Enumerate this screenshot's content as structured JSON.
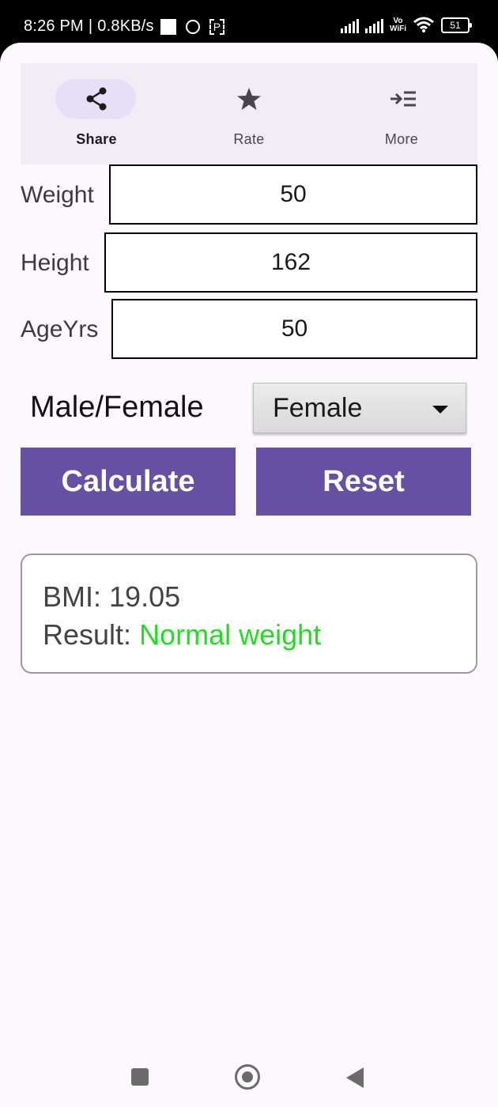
{
  "status_bar": {
    "time": "8:26 PM",
    "network_speed": "0.8KB/s",
    "vowifi_top": "Vo",
    "vowifi_bottom": "WiFi",
    "battery": "51",
    "icons": [
      "notification-square-icon",
      "app-badge-icon",
      "p-icon",
      "signal-icon",
      "wifi-icon",
      "battery-icon"
    ]
  },
  "top_nav": {
    "items": [
      {
        "label": "Share",
        "icon": "share-icon",
        "active": true
      },
      {
        "label": "Rate",
        "icon": "star-icon",
        "active": false
      },
      {
        "label": "More",
        "icon": "more-list-icon",
        "active": false
      }
    ]
  },
  "form": {
    "weight": {
      "label": "Weight",
      "value": "50"
    },
    "height": {
      "label": "Height",
      "value": "162"
    },
    "age": {
      "label": "AgeYrs",
      "value": "50"
    },
    "gender": {
      "label": "Male/Female",
      "selected": "Female"
    }
  },
  "actions": {
    "calculate_label": "Calculate",
    "reset_label": "Reset"
  },
  "result": {
    "bmi_label": "BMI:",
    "bmi_value": "19.05",
    "result_label": "Result:",
    "result_value": "Normal weight"
  },
  "colors": {
    "accent": "#6750a4",
    "result_ok": "#22dd22",
    "nav_background": "#f2ecf7",
    "active_pill": "#e8def8"
  },
  "system_nav": {
    "icons": [
      "recents-square-icon",
      "home-circle-icon",
      "back-triangle-icon"
    ]
  }
}
